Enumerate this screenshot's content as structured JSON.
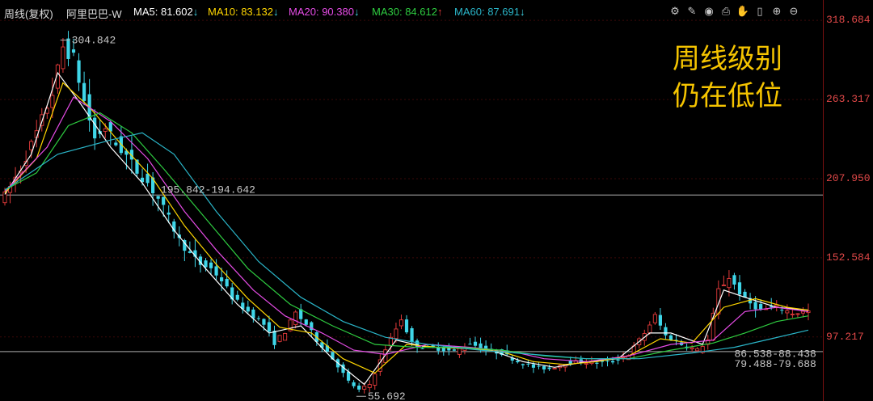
{
  "legend": {
    "period": "周线(复权)",
    "stock": "阿里巴巴-W",
    "ma5_label": "MA5:",
    "ma5_value": "81.602",
    "ma5_arrow": "↓",
    "ma10_label": "MA10:",
    "ma10_value": "83.132",
    "ma10_arrow": "↓",
    "ma20_label": "MA20:",
    "ma20_value": "90.380",
    "ma20_arrow": "↓",
    "ma30_label": "MA30:",
    "ma30_value": "84.612",
    "ma30_arrow": "↑",
    "ma60_label": "MA60:",
    "ma60_value": "87.691",
    "ma60_arrow": "↓"
  },
  "colors": {
    "ma5": "#ffffff",
    "ma10": "#ffd600",
    "ma20": "#e64ce6",
    "ma30": "#2ecc40",
    "ma60": "#2ab5c8",
    "up": "#e23a3a",
    "down": "#3fd6e8",
    "price_axis": "#e04848",
    "note": "#f5c400"
  },
  "toolbar": {
    "icons": [
      "gear-icon",
      "pen-icon",
      "eye-icon",
      "printer-icon",
      "hand-icon",
      "bookmark-icon",
      "zoom-in-icon",
      "zoom-out-icon"
    ]
  },
  "note": {
    "line1": "周线级别",
    "line2": "仍在低位"
  },
  "chart_data": {
    "type": "candlestick",
    "price_axis": {
      "ylim": [
        53,
        325
      ],
      "ticks": [
        "318.684",
        "263.317",
        "207.950",
        "152.584",
        "97.217"
      ]
    },
    "annotations": [
      {
        "text": "304.842",
        "price": 304.842
      },
      {
        "text": "195.842-194.642",
        "price": 195.842
      },
      {
        "text": "55.692",
        "price": 55.692
      },
      {
        "text": "86.538-88.438",
        "price": 86.538
      },
      {
        "text": "79.488-79.688",
        "price": 79.488
      }
    ],
    "hlines": [
      196.5,
      87.0
    ],
    "price_path": [
      [
        0,
        196
      ],
      [
        3,
        215
      ],
      [
        6,
        240
      ],
      [
        9,
        268
      ],
      [
        11,
        300
      ],
      [
        13,
        292
      ],
      [
        15,
        262
      ],
      [
        17,
        236
      ],
      [
        19,
        244
      ],
      [
        21,
        232
      ],
      [
        23,
        224
      ],
      [
        25,
        213
      ],
      [
        27,
        205
      ],
      [
        29,
        194
      ],
      [
        31,
        180
      ],
      [
        33,
        165
      ],
      [
        35,
        155
      ],
      [
        37,
        148
      ],
      [
        39,
        145
      ],
      [
        41,
        137
      ],
      [
        43,
        125
      ],
      [
        45,
        118
      ],
      [
        47,
        112
      ],
      [
        49,
        106
      ],
      [
        51,
        93
      ],
      [
        53,
        101
      ],
      [
        55,
        114
      ],
      [
        57,
        106
      ],
      [
        59,
        95
      ],
      [
        61,
        87
      ],
      [
        63,
        77
      ],
      [
        65,
        66
      ],
      [
        67,
        60
      ],
      [
        69,
        64
      ],
      [
        72,
        89
      ],
      [
        75,
        110
      ],
      [
        77,
        93
      ],
      [
        79,
        90
      ],
      [
        82,
        89
      ],
      [
        85,
        87
      ],
      [
        88,
        93
      ],
      [
        91,
        88
      ],
      [
        94,
        86
      ],
      [
        97,
        80
      ],
      [
        100,
        76
      ],
      [
        103,
        75
      ],
      [
        106,
        79
      ],
      [
        109,
        80
      ],
      [
        112,
        79
      ],
      [
        115,
        80
      ],
      [
        118,
        85
      ],
      [
        121,
        100
      ],
      [
        123,
        112
      ],
      [
        125,
        98
      ],
      [
        128,
        92
      ],
      [
        131,
        88
      ],
      [
        133,
        95
      ],
      [
        135,
        130
      ],
      [
        137,
        139
      ],
      [
        140,
        123
      ],
      [
        143,
        116
      ],
      [
        146,
        118
      ],
      [
        149,
        114
      ],
      [
        152,
        115
      ]
    ],
    "moving_averages": [
      {
        "name": "MA5",
        "points": [
          [
            0,
            197
          ],
          [
            5,
            225
          ],
          [
            10,
            282
          ],
          [
            14,
            262
          ],
          [
            20,
            230
          ],
          [
            26,
            205
          ],
          [
            32,
            172
          ],
          [
            38,
            145
          ],
          [
            44,
            120
          ],
          [
            50,
            100
          ],
          [
            56,
            105
          ],
          [
            62,
            82
          ],
          [
            68,
            64
          ],
          [
            74,
            95
          ],
          [
            80,
            90
          ],
          [
            86,
            90
          ],
          [
            92,
            88
          ],
          [
            98,
            80
          ],
          [
            104,
            76
          ],
          [
            110,
            80
          ],
          [
            116,
            82
          ],
          [
            122,
            100
          ],
          [
            126,
            100
          ],
          [
            132,
            92
          ],
          [
            136,
            130
          ],
          [
            140,
            125
          ],
          [
            146,
            118
          ],
          [
            152,
            116
          ]
        ]
      },
      {
        "name": "MA10",
        "points": [
          [
            0,
            198
          ],
          [
            6,
            222
          ],
          [
            11,
            275
          ],
          [
            16,
            258
          ],
          [
            22,
            232
          ],
          [
            28,
            208
          ],
          [
            34,
            175
          ],
          [
            40,
            148
          ],
          [
            46,
            124
          ],
          [
            52,
            104
          ],
          [
            58,
            100
          ],
          [
            64,
            82
          ],
          [
            70,
            72
          ],
          [
            76,
            92
          ],
          [
            82,
            90
          ],
          [
            88,
            89
          ],
          [
            94,
            87
          ],
          [
            100,
            80
          ],
          [
            106,
            78
          ],
          [
            112,
            80
          ],
          [
            118,
            84
          ],
          [
            124,
            96
          ],
          [
            130,
            93
          ],
          [
            136,
            118
          ],
          [
            142,
            124
          ],
          [
            148,
            118
          ],
          [
            152,
            116
          ]
        ]
      },
      {
        "name": "MA20",
        "points": [
          [
            0,
            199
          ],
          [
            8,
            230
          ],
          [
            13,
            265
          ],
          [
            20,
            248
          ],
          [
            27,
            222
          ],
          [
            34,
            185
          ],
          [
            40,
            158
          ],
          [
            47,
            130
          ],
          [
            53,
            112
          ],
          [
            60,
            100
          ],
          [
            66,
            88
          ],
          [
            72,
            85
          ],
          [
            80,
            92
          ],
          [
            88,
            90
          ],
          [
            96,
            87
          ],
          [
            102,
            82
          ],
          [
            110,
            80
          ],
          [
            118,
            84
          ],
          [
            126,
            92
          ],
          [
            134,
            95
          ],
          [
            140,
            115
          ],
          [
            146,
            118
          ],
          [
            152,
            115
          ]
        ]
      },
      {
        "name": "MA30",
        "points": [
          [
            0,
            200
          ],
          [
            6,
            212
          ],
          [
            12,
            245
          ],
          [
            18,
            254
          ],
          [
            24,
            240
          ],
          [
            30,
            215
          ],
          [
            38,
            180
          ],
          [
            46,
            145
          ],
          [
            54,
            120
          ],
          [
            62,
            105
          ],
          [
            70,
            92
          ],
          [
            78,
            90
          ],
          [
            86,
            90
          ],
          [
            94,
            88
          ],
          [
            102,
            84
          ],
          [
            110,
            82
          ],
          [
            118,
            82
          ],
          [
            126,
            88
          ],
          [
            134,
            93
          ],
          [
            140,
            100
          ],
          [
            146,
            108
          ],
          [
            152,
            112
          ]
        ]
      },
      {
        "name": "MA60",
        "points": [
          [
            0,
            200
          ],
          [
            10,
            225
          ],
          [
            20,
            235
          ],
          [
            26,
            240
          ],
          [
            32,
            225
          ],
          [
            40,
            185
          ],
          [
            48,
            150
          ],
          [
            56,
            125
          ],
          [
            64,
            108
          ],
          [
            72,
            97
          ],
          [
            80,
            92
          ],
          [
            90,
            88
          ],
          [
            100,
            85
          ],
          [
            110,
            82
          ],
          [
            120,
            82
          ],
          [
            130,
            86
          ],
          [
            138,
            90
          ],
          [
            145,
            96
          ],
          [
            152,
            102
          ]
        ]
      }
    ]
  }
}
